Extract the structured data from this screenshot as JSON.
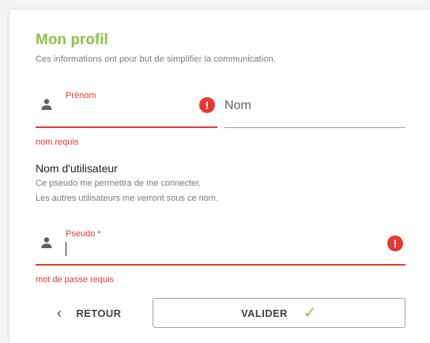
{
  "header": {
    "title": "Mon profil",
    "subtitle": "Ces informations ont pour but de simplifier la communication."
  },
  "fields": {
    "first_name": {
      "label": "Prénom",
      "value": "",
      "error": "nom requis"
    },
    "last_name": {
      "label": "Nom",
      "value": ""
    },
    "username_section": {
      "title": "Nom d'utilisateur",
      "desc_line1": "Ce pseudo me permettra de me connecter.",
      "desc_line2": "Les autres utilisateurs me verront sous ce nom."
    },
    "pseudo": {
      "label": "Pseudo *",
      "value": "",
      "error": "mot de passe requis"
    }
  },
  "actions": {
    "back_label": "RETOUR",
    "back_icon": "chevron-left-icon",
    "validate_label": "VALIDER",
    "validate_icon": "check-icon"
  },
  "colors": {
    "accent": "#8bc34a",
    "error": "#e53935",
    "text": "#212121",
    "muted": "#7a7a7a"
  }
}
